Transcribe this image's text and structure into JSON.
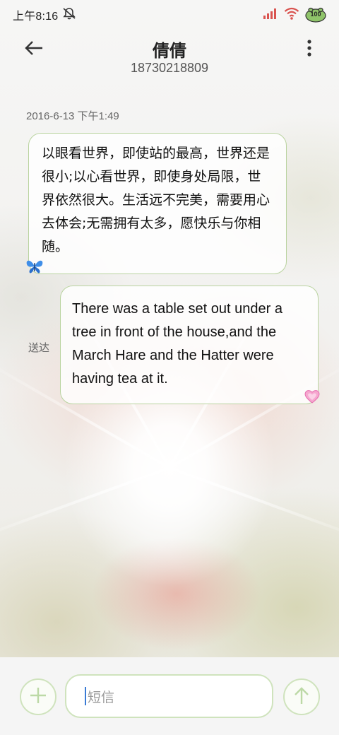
{
  "status_bar": {
    "time": "上午8:16",
    "battery_label": "100"
  },
  "header": {
    "contact_name": "倩倩",
    "phone_number": "18730218809"
  },
  "conversation": {
    "timestamp": "2016-6-13 下午1:49",
    "incoming_message": "以眼看世界，即使站的最高，世界还是很小;以心看世界，即使身处局限，世界依然很大。生活远不完美，需要用心去体会;无需拥有太多，愿快乐与你相随。",
    "outgoing_message": "There was a table set out under a tree in front of the house,and the March Hare and the Hatter were having tea at it.",
    "delivery_status": "送达"
  },
  "compose": {
    "placeholder": "短信"
  },
  "colors": {
    "bubble_border": "#b9d39f",
    "accent_green": "#cfe3bd",
    "caret_blue": "#3a7bd5"
  },
  "icons": {
    "back": "arrow-left-icon",
    "more": "more-vertical-icon",
    "add": "plus-icon",
    "send": "arrow-up-icon",
    "sticker_incoming": "butterfly-icon",
    "sticker_outgoing": "heart-icon"
  }
}
